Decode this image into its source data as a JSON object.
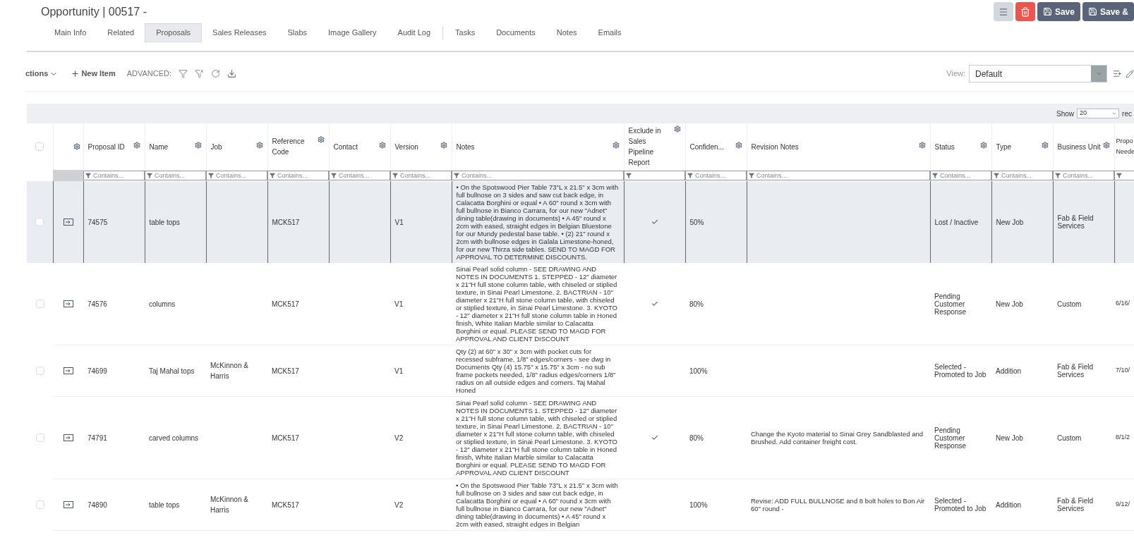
{
  "header": {
    "title": "Opportunity | 00517 -",
    "buttons": [
      {
        "kind": "menu"
      },
      {
        "kind": "delete"
      },
      {
        "kind": "save",
        "label": "Save"
      },
      {
        "kind": "save",
        "label": "Save &"
      }
    ]
  },
  "tabs": [
    {
      "label": "Main Info",
      "selected": false
    },
    {
      "label": "Related",
      "selected": false
    },
    {
      "label": "Proposals",
      "selected": true
    },
    {
      "label": "Sales Releases",
      "selected": false
    },
    {
      "label": "Slabs",
      "selected": false
    },
    {
      "label": "Image Gallery",
      "selected": false
    },
    {
      "label": "Audit Log",
      "selected": false,
      "divider_after": true
    },
    {
      "label": "Tasks",
      "selected": false
    },
    {
      "label": "Documents",
      "selected": false
    },
    {
      "label": "Notes",
      "selected": false
    },
    {
      "label": "Emails",
      "selected": false
    }
  ],
  "toolbar": {
    "actions": "ctions",
    "new_item": "New Item",
    "advanced": "ADVANCED:",
    "view_label": "View:",
    "view_value": "Default"
  },
  "grid": {
    "show_label": "Show",
    "page_size": "20",
    "records_label": "rec",
    "all_checked": false,
    "columns": [
      {
        "label": "Proposal ID",
        "placeholder": "Contains...",
        "settings": true
      },
      {
        "label": "Name",
        "placeholder": "Contains...",
        "settings": true
      },
      {
        "label": "Job",
        "placeholder": "Contains...",
        "settings": true
      },
      {
        "label": "Reference Code",
        "placeholder": "Contains...",
        "settings": true
      },
      {
        "label": "Contact",
        "placeholder": "Contains...",
        "settings": true
      },
      {
        "label": "Version",
        "placeholder": "Contains...",
        "settings": true
      },
      {
        "label": "Notes",
        "placeholder": "Contains...",
        "settings": true
      },
      {
        "label": "Exclude in Sales Pipeline Report",
        "settings": true
      },
      {
        "label": "Confiden...",
        "placeholder": "Contains...",
        "settings": true
      },
      {
        "label": "Revision Notes",
        "placeholder": "Contains...",
        "settings": true
      },
      {
        "label": "Status",
        "placeholder": "Contains...",
        "settings": true
      },
      {
        "label": "Type",
        "placeholder": "Contains...",
        "settings": true
      },
      {
        "label": "Business Unit",
        "placeholder": "Contains...",
        "settings": true
      },
      {
        "label": "Propo Neede",
        "settings": false
      }
    ],
    "rows": [
      {
        "selected": true,
        "checked": false,
        "id": "74575",
        "name": "table tops",
        "reference": "MCK517",
        "version": "V1",
        "notes": "• On the Spotswood Pier Table 73\"L x 21.5\" x 3cm with full bullnose on 3 sides and saw cut back edge, in Calacatta Borghini or equal • A 60\" round x 3cm with full bullnose in Bianco Carrara, for our new \"Adnet\" dining table(drawing in documents) • A 45\" round x 2cm with eased, straight edges in Belgian Bluestone for our Mundy pedestal base table. • (2) 21\" round x 2cm with bullnose edges in Galala Limestone-honed, for our new Thirza side tables. SEND TO MAGD FOR APPROVAL TO DETERMINE DISCOUNTS.",
        "excluded": true,
        "confidence": "50%",
        "status": "Lost / Inactive",
        "type": "New Job",
        "business_unit": "Fab & Field Services"
      },
      {
        "selected": false,
        "checked": false,
        "id": "74576",
        "name": "columns",
        "reference": "MCK517",
        "version": "V1",
        "notes": "Sinai Pearl solid column - SEE DRAWING AND NOTES IN DOCUMENTS 1. STEPPED - 12\" diameter x 21\"H full stone column table, with chiseled or stiplied texture, in Sinai Pearl Limestone. 2. BACTRIAN - 10\" diameter x 21\"H full stone column table, with chiseled or stiplied texture, in Sinai Pearl Limestone. 3. KYOTO - 12\" diameter x 21\"H full stone column table in Honed finish, White Italian Marble similar to Calacatta Borghini or equal. PLEASE SEND TO MAGD FOR APPROVAL AND CLIENT DISCOUNT",
        "excluded": true,
        "confidence": "80%",
        "status": "Pending Customer Response",
        "type": "New Job",
        "business_unit": "Custom",
        "proposal_needed": "6/16/"
      },
      {
        "selected": false,
        "checked": false,
        "id": "74699",
        "name": "Taj Mahal tops",
        "job": "McKinnon & Harris",
        "reference": "MCK517",
        "version": "V1",
        "notes": "Qty (2) at 60\" x 30\" x 3cm with pocket cuts for recessed subframe, 1/8\" edges/corners - see dwg in Documents Qty (4) 15.75\" x 15.75\" x 3cm - no sub frame pockets needed, 1/8\" radius edges/corners 1/8\" radius on all outside edges and corners. Taj Mahal Honed",
        "excluded": false,
        "confidence": "100%",
        "status": "Selected - Promoted to Job",
        "type": "Addition",
        "business_unit": "Fab & Field Services",
        "proposal_needed": "7/10/"
      },
      {
        "selected": false,
        "checked": false,
        "id": "74791",
        "name": "carved columns",
        "reference": "MCK517",
        "version": "V2",
        "notes": "Sinai Pearl solid column - SEE DRAWING AND NOTES IN DOCUMENTS 1. STEPPED - 12\" diameter x 21\"H full stone column table, with chiseled or stiplied texture, in Sinai Pearl Limestone. 2. BACTRIAN - 10\" diameter x 21\"H full stone column table, with chiseled or stiplied texture, in Sinai Pearl Limestone. 3. KYOTO - 12\" diameter x 21\"H full stone column table in Honed finish, White Italian Marble similar to Calacatta Borghini or equal. PLEASE SEND TO MAGD FOR APPROVAL AND CLIENT DISCOUNT",
        "excluded": true,
        "confidence": "80%",
        "revision_notes": "Change the Kyoto material to Sinai Grey Sandblasted and Brushed. Add container freight cost.",
        "status": "Pending Customer Response",
        "type": "New Job",
        "business_unit": "Custom",
        "proposal_needed": "8/1/2"
      },
      {
        "selected": false,
        "checked": false,
        "id": "74890",
        "name": "table tops",
        "job": "McKinnon & Harris",
        "reference": "MCK517",
        "version": "V2",
        "notes": "• On the Spotswood Pier Table 73\"L x 21.5\" x 3cm with full bullnose on 3 sides and saw cut back edge, in Calacatta Borghini or equal • A 60\" round x 3cm with full bullnose in Bianco Carrara, for our new \"Adnet\" dining table(drawing in documents) • A 45\" round x 2cm with eased, straight edges in Belgian",
        "excluded": false,
        "confidence": "100%",
        "revision_notes": "Revise: ADD FULL BULLNOSE and 8 bolt holes to Bon Air 60\" round -",
        "status": "Selected - Promoted to Job",
        "type": "Addition",
        "business_unit": "Fab & Field Services",
        "proposal_needed": "9/12/"
      }
    ]
  }
}
